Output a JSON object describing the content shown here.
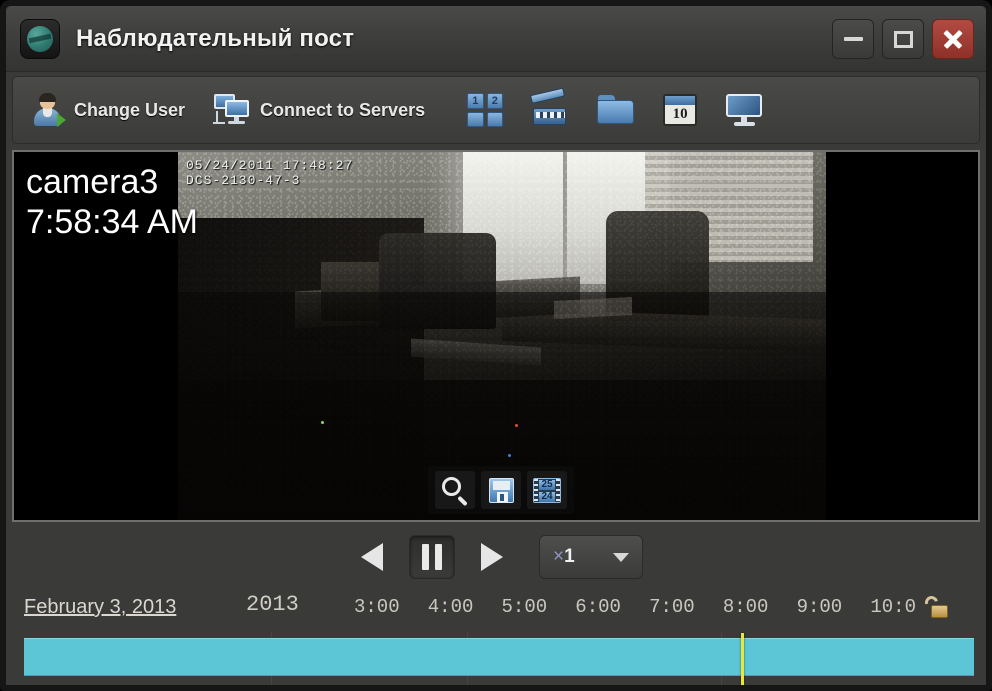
{
  "window": {
    "title": "Наблюдательный пост",
    "app_icon": "globe-logo-icon",
    "controls": {
      "minimize": "minimize-icon",
      "maximize": "maximize-icon",
      "close": "close-icon"
    }
  },
  "toolbar": {
    "items": [
      {
        "label": "Change User",
        "icon": "user-switch-icon"
      },
      {
        "label": "Connect to Servers",
        "icon": "servers-monitor-icon"
      }
    ],
    "icon_buttons": [
      {
        "icon": "grid-layout-icon",
        "cells": [
          "1",
          "2",
          "",
          ""
        ]
      },
      {
        "icon": "clapperboard-icon"
      },
      {
        "icon": "folder-icon"
      },
      {
        "icon": "calendar-icon",
        "day": "10"
      },
      {
        "icon": "monitor-icon"
      }
    ]
  },
  "video": {
    "camera_label": "camera3",
    "time_overlay": "7:58:34 AM",
    "camera_osd_line1": "05/24/2011 17:48:27",
    "camera_osd_line2": "DCS-2130-47-3",
    "tools": [
      {
        "icon": "magnifier-icon"
      },
      {
        "icon": "floppy-save-icon"
      },
      {
        "icon": "film-frames-icon",
        "frame_top": "25",
        "frame_bottom": "24"
      }
    ]
  },
  "transport": {
    "reverse": "play-reverse-icon",
    "pause": "pause-icon",
    "forward": "play-forward-icon",
    "pause_active": true,
    "speed_prefix": "×",
    "speed_value": "1",
    "speed_caret": "chevron-down-icon"
  },
  "timeline": {
    "date_link": "February 3, 2013",
    "year": "2013",
    "ticks": [
      "3:00",
      "4:00",
      "5:00",
      "6:00",
      "7:00",
      "8:00",
      "9:00",
      "10:0"
    ],
    "lock_icon": "unlocked-padlock-icon",
    "playhead_percent": 75.5,
    "track_color": "#5cc6d6",
    "playhead_color": "#e8e839"
  }
}
